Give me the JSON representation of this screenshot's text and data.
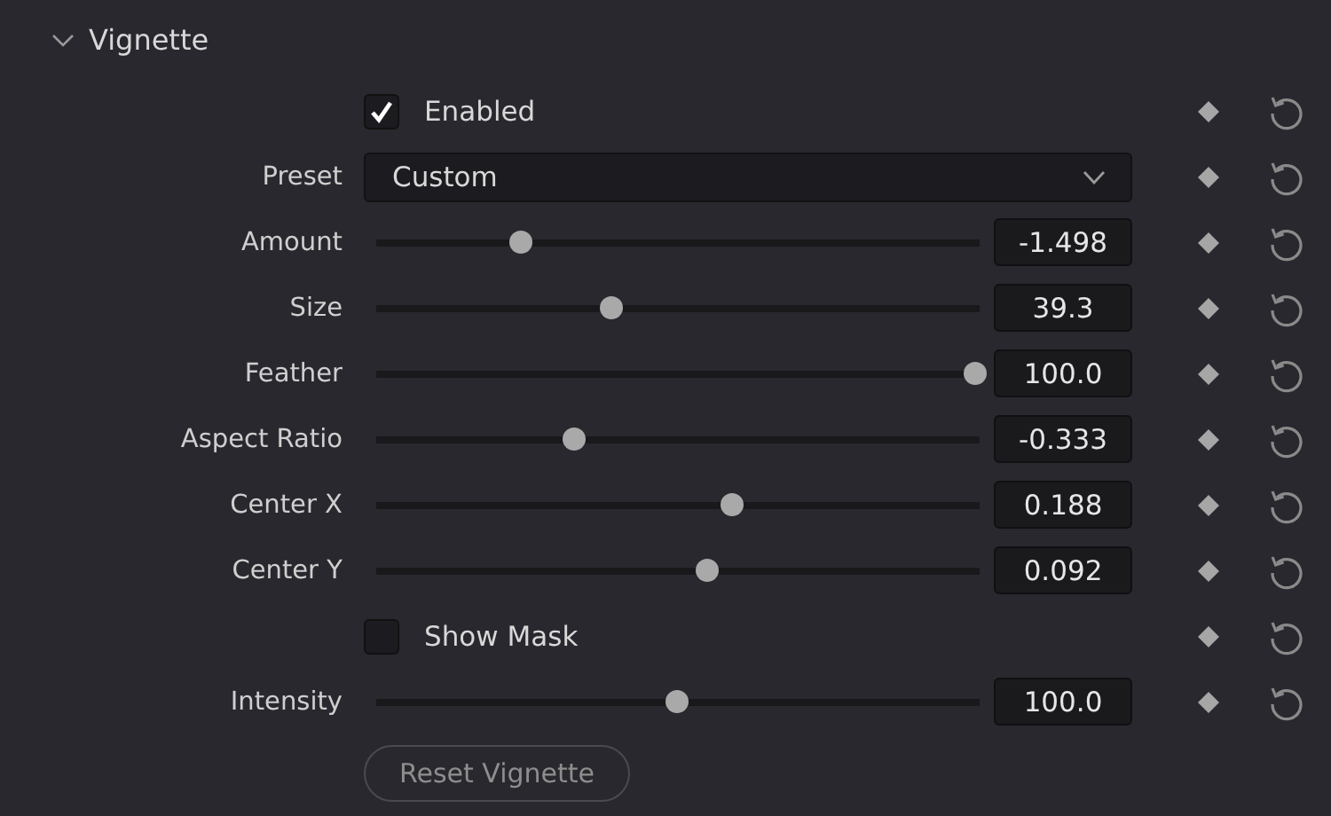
{
  "section": {
    "title": "Vignette",
    "expanded": true
  },
  "rows": [
    {
      "kind": "checkbox",
      "label": "Enabled",
      "checked": true
    },
    {
      "kind": "dropdown",
      "label": "Preset",
      "value": "Custom"
    },
    {
      "kind": "slider",
      "label": "Amount",
      "level": 0.24,
      "value": "-1.498"
    },
    {
      "kind": "slider",
      "label": "Size",
      "level": 0.39,
      "value": "39.3"
    },
    {
      "kind": "slider",
      "label": "Feather",
      "level": 0.995,
      "value": "100.0"
    },
    {
      "kind": "slider",
      "label": "Aspect Ratio",
      "level": 0.33,
      "value": "-0.333"
    },
    {
      "kind": "slider",
      "label": "Center X",
      "level": 0.59,
      "value": "0.188"
    },
    {
      "kind": "slider",
      "label": "Center Y",
      "level": 0.55,
      "value": "0.092"
    },
    {
      "kind": "checkbox",
      "label": "Show Mask",
      "checked": false
    },
    {
      "kind": "slider",
      "label": "Intensity",
      "level": 0.5,
      "value": "100.0"
    }
  ],
  "reset_button": "Reset Vignette"
}
